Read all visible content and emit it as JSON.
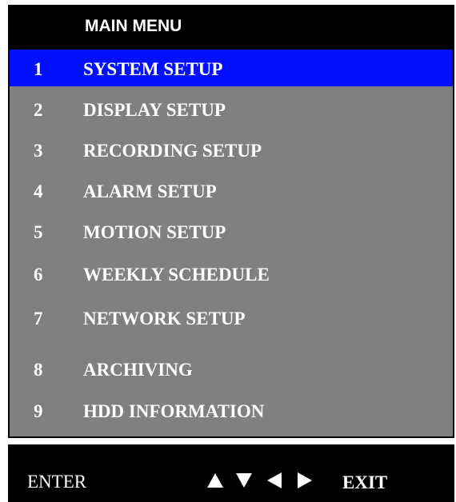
{
  "menu": {
    "title": "MAIN MENU",
    "items": [
      {
        "num": "1",
        "label": "SYSTEM SETUP",
        "selected": true
      },
      {
        "num": "2",
        "label": "DISPLAY SETUP"
      },
      {
        "num": "3",
        "label": "RECORDING SETUP"
      },
      {
        "num": "4",
        "label": "ALARM SETUP"
      },
      {
        "num": "5",
        "label": "MOTION SETUP"
      },
      {
        "num": "6",
        "label": "WEEKLY SCHEDULE"
      },
      {
        "num": "7",
        "label": "NETWORK SETUP"
      },
      {
        "num": "8",
        "label": "ARCHIVING"
      },
      {
        "num": "9",
        "label": "HDD INFORMATION"
      }
    ]
  },
  "nav": {
    "enter_label": "ENTER",
    "arrows": [
      "arrow-up-icon",
      "arrow-down-icon",
      "arrow-left-icon",
      "arrow-right-icon"
    ],
    "exit_label": "EXIT"
  },
  "colors": {
    "panel": "#808080",
    "selected": "#0010ff",
    "title_bar": "#000000",
    "text": "#ffffff"
  }
}
